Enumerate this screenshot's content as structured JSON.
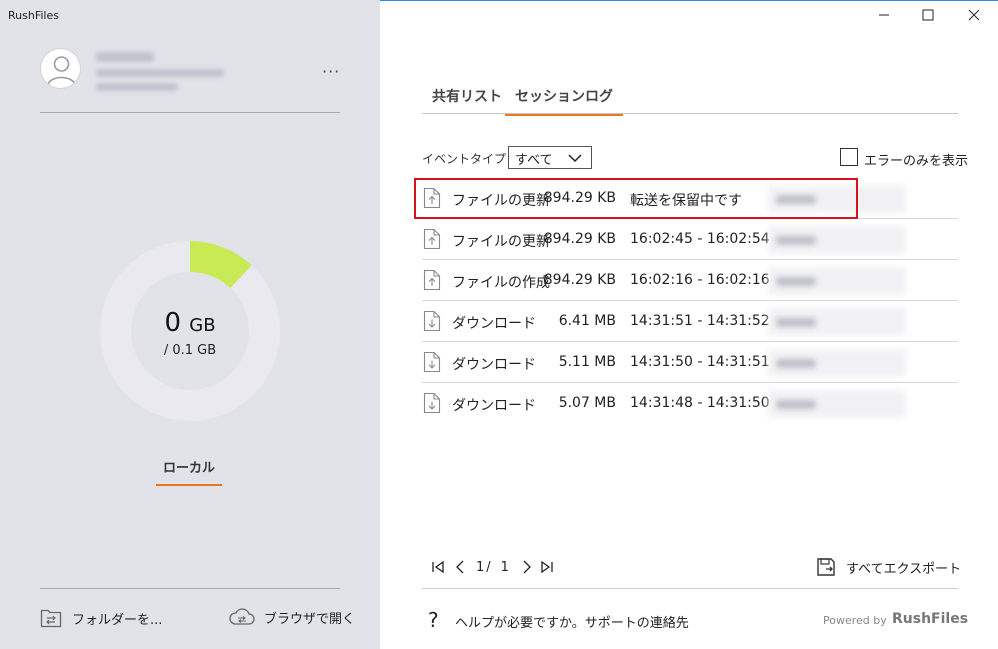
{
  "app": {
    "title": "RushFiles"
  },
  "account": {
    "more_label": "···"
  },
  "storage": {
    "used_value": "0",
    "used_unit": "GB",
    "total_text": "/  0.1 GB",
    "used_fraction": 0.12,
    "ring_color": "#e9e9ef",
    "fill_color": "#c8ea55"
  },
  "sidebar": {
    "local_tab_label": "ローカル",
    "folder_action_label": "フォルダーを...",
    "browser_action_label": "ブラウザで開く",
    "folder_icon": "folder-sync-icon",
    "browser_icon": "cloud-sync-icon"
  },
  "window": {
    "minimize_icon": "minimize-icon",
    "maximize_icon": "maximize-icon",
    "close_icon": "close-icon"
  },
  "tabs": [
    {
      "label": "共有リスト",
      "active": false
    },
    {
      "label": "セッションログ",
      "active": true
    }
  ],
  "filter": {
    "label": "イベントタイプ",
    "selected": "すべて",
    "errors_only_label": "エラーのみを表示",
    "errors_only_checked": false
  },
  "log": {
    "highlighted_row": 0,
    "rows": [
      {
        "icon": "upload-file-icon",
        "event": "ファイルの更新",
        "size": "894.29 KB",
        "time": "転送を保留中です"
      },
      {
        "icon": "upload-file-icon",
        "event": "ファイルの更新",
        "size": "894.29 KB",
        "time": "16:02:45 - 16:02:54"
      },
      {
        "icon": "upload-file-icon",
        "event": "ファイルの作成",
        "size": "894.29 KB",
        "time": "16:02:16 - 16:02:16"
      },
      {
        "icon": "download-file-icon",
        "event": "ダウンロード",
        "size": "6.41 MB",
        "time": "14:31:51 - 14:31:52"
      },
      {
        "icon": "download-file-icon",
        "event": "ダウンロード",
        "size": "5.11 MB",
        "time": "14:31:50 - 14:31:51"
      },
      {
        "icon": "download-file-icon",
        "event": "ダウンロード",
        "size": "5.07 MB",
        "time": "14:31:48 - 14:31:50"
      }
    ]
  },
  "pagination": {
    "current": "1",
    "separator": "/",
    "total": "1"
  },
  "export": {
    "label": "すべてエクスポート",
    "icon": "save-export-icon"
  },
  "help": {
    "icon_text": "?",
    "text": "ヘルプが必要ですか。サポートの連絡先"
  },
  "footer": {
    "powered_by": "Powered by",
    "brand": "RushFiles"
  }
}
